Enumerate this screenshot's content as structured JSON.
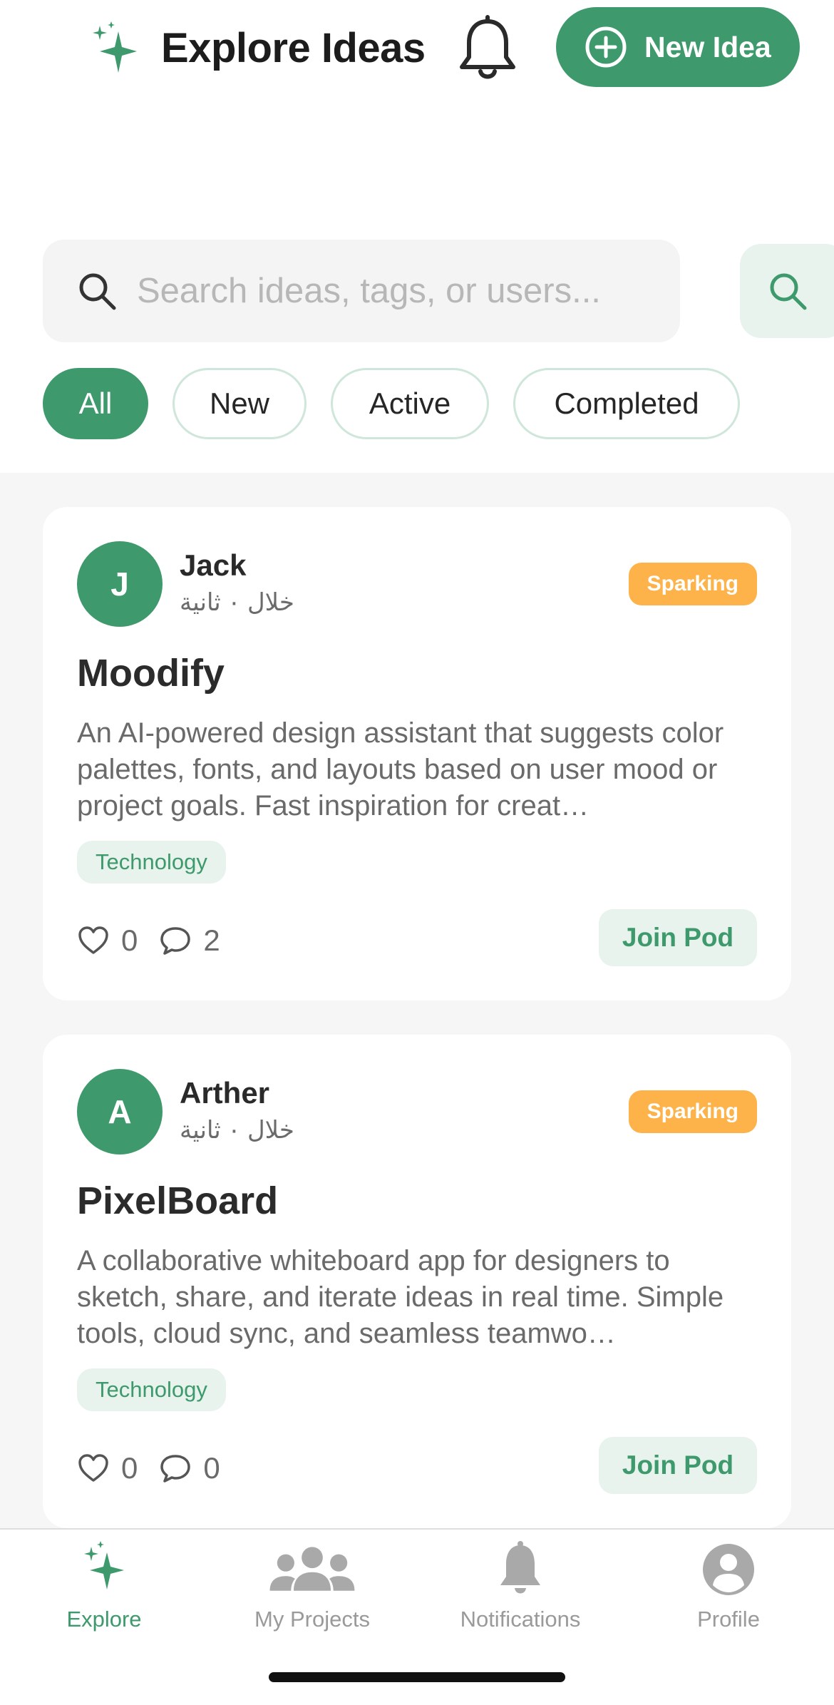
{
  "header": {
    "title": "Explore Ideas",
    "brand_icon": "sparkles-icon",
    "notifications_icon": "bell-icon",
    "new_idea_label": "New Idea",
    "new_idea_icon": "plus-circle-icon"
  },
  "search": {
    "placeholder": "Search ideas, tags, or users...",
    "value": "",
    "icon": "search-icon",
    "button_icon": "search-icon"
  },
  "filters": [
    {
      "label": "All",
      "active": true
    },
    {
      "label": "New",
      "active": false
    },
    {
      "label": "Active",
      "active": false
    },
    {
      "label": "Completed",
      "active": false
    }
  ],
  "ideas": [
    {
      "author_initial": "J",
      "author": "Jack",
      "time": "خلال ٠ ثانية",
      "status": "Sparking",
      "title": "Moodify",
      "description": "An AI-powered design assistant that suggests color palettes, fonts, and layouts based on user mood or project goals. Fast inspiration for creat…",
      "tag": "Technology",
      "likes": "0",
      "comments": "2",
      "action_label": "Join Pod"
    },
    {
      "author_initial": "A",
      "author": "Arther",
      "time": "خلال ٠ ثانية",
      "status": "Sparking",
      "title": "PixelBoard",
      "description": "A collaborative whiteboard app for designers to sketch, share, and iterate ideas in real time. Simple tools, cloud sync, and seamless teamwo…",
      "tag": "Technology",
      "likes": "0",
      "comments": "0",
      "action_label": "Join Pod"
    }
  ],
  "tabbar": [
    {
      "label": "Explore",
      "icon": "sparkles-icon",
      "active": true
    },
    {
      "label": "My Projects",
      "icon": "people-icon",
      "active": false
    },
    {
      "label": "Notifications",
      "icon": "bell-icon",
      "active": false
    },
    {
      "label": "Profile",
      "icon": "person-circle-icon",
      "active": false
    }
  ],
  "colors": {
    "accent": "#3e9a6c",
    "accent_light": "#e7f3ec",
    "status_sparking": "#fdb24a",
    "inactive_tab": "#9a9a9a"
  }
}
